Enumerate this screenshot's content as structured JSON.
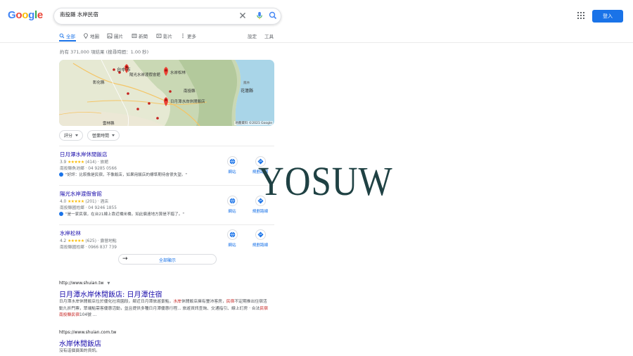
{
  "header": {
    "logo": "Google",
    "query": "南投縣 水岸民宿",
    "login_label": "登入"
  },
  "tabs": [
    {
      "label": "全部",
      "icon": "search-icon",
      "active": true
    },
    {
      "label": "地圖",
      "icon": "map-pin-icon"
    },
    {
      "label": "圖片",
      "icon": "image-icon"
    },
    {
      "label": "新聞",
      "icon": "news-icon"
    },
    {
      "label": "影片",
      "icon": "video-icon"
    },
    {
      "label": "更多",
      "icon": "more-dots-icon"
    }
  ],
  "tools": {
    "settings": "設定",
    "tools": "工具"
  },
  "stats": "約有 371,000 項結果 (搜尋時間：1.00 秒)",
  "map": {
    "labels": {
      "taichung": "台中市",
      "changhua": "彰化縣",
      "nantou": "南投縣",
      "hualien": "花蓮縣",
      "yunlin": "雲林縣",
      "fenglin": "鳳林"
    },
    "pins": [
      "陽光水岸渡假會館",
      "水岸松林",
      "日月潭水岸休閒飯店"
    ],
    "attribution": "地圖資料 ©2021 Google"
  },
  "chips": [
    {
      "label": "評分"
    },
    {
      "label": "營業時間"
    }
  ],
  "places": [
    {
      "name": "日月潭水岸休閒飯店",
      "rating": "3.9",
      "reviews": "(414)",
      "type": "· 旅館",
      "address": "南投縣魚池鄉 · 04 9285 0566",
      "review": "\"好評：比較像是民宿，不像飯店，如果用飯店的標準期待會很失望。\"",
      "website_label": "網站",
      "directions_label": "規劃路線"
    },
    {
      "name": "陽光水岸渡假會館",
      "rating": "4.0",
      "reviews": "(201)",
      "type": "· 酒店",
      "address": "南投縣國姓鄉 · 04 9246 1855",
      "review": "\"是一家民宿，在台21線上靠近橋米橋，如此偏遠地方算是不錯了。\"",
      "website_label": "網站",
      "directions_label": "規劃路線"
    },
    {
      "name": "水岸松林",
      "rating": "4.2",
      "reviews": "(625)",
      "type": "· 露營地點",
      "address": "南投縣國姓鄉 · 0966 837 739",
      "review": "",
      "website_label": "網站",
      "directions_label": "規劃路線"
    }
  ],
  "more_button": "全部顯示",
  "results": [
    {
      "url": "http://www.shuian.tw",
      "title": "日月潭水岸休閒飯店: 日月潭住宿",
      "snippet_html": "日月潭水岸休閒飯店位於優化社境園段，鄰近日月潭旅遊景點，水岸休閒飯店擁有豐沛客房，民宿不定期推出住宿活動九折門票，眾端點需客優惠活動，並且提供多種日月潭優惠行程... 旅遊資訊查詢、交通指引、線上訂房 · 合法民宿 南投縣民宿104號 ..."
    },
    {
      "url": "https://www.shuian.com.tw",
      "title": "水岸休閒飯店",
      "snippet_html": "沒有這個頁面的資訊。"
    }
  ],
  "watermark": "YOSUW",
  "colors": {
    "accent": "#1a73e8",
    "link": "#1a0dab",
    "star": "#fbbc04",
    "highlight": "#c5221f"
  }
}
